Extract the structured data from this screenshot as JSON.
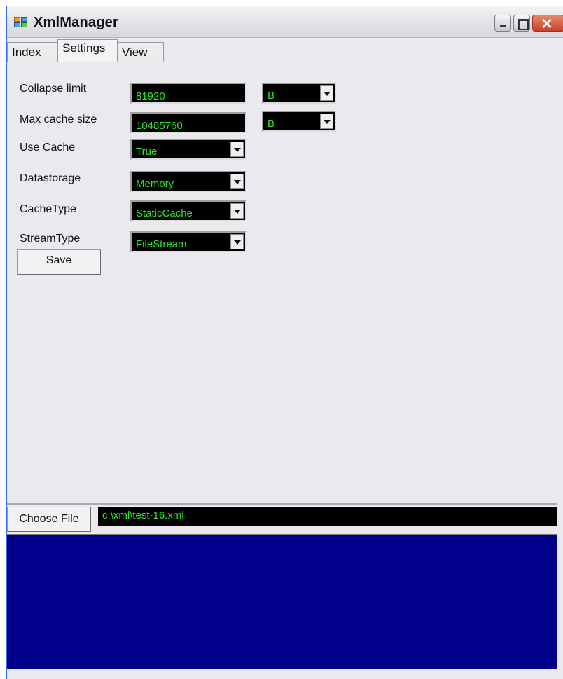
{
  "window": {
    "title": "XmlManager"
  },
  "tabs": [
    {
      "label": "Index"
    },
    {
      "label": "Settings"
    },
    {
      "label": "View"
    }
  ],
  "settings": {
    "collapse_limit": {
      "label": "Collapse limit",
      "value": "81920",
      "unit": "B"
    },
    "max_cache_size": {
      "label": "Max cache size",
      "value": "10485760",
      "unit": "B"
    },
    "use_cache": {
      "label": "Use Cache",
      "value": "True"
    },
    "datastorage": {
      "label": "Datastorage",
      "value": "Memory"
    },
    "cache_type": {
      "label": "CacheType",
      "value": "StaticCache"
    },
    "stream_type": {
      "label": "StreamType",
      "value": "FileStream"
    },
    "save_label": "Save"
  },
  "file": {
    "choose_label": "Choose File",
    "path": "c:\\xml\\test-16.xml"
  },
  "colors": {
    "field_bg": "#000000",
    "field_text": "#2ee62e",
    "output_bg": "#00008b"
  }
}
